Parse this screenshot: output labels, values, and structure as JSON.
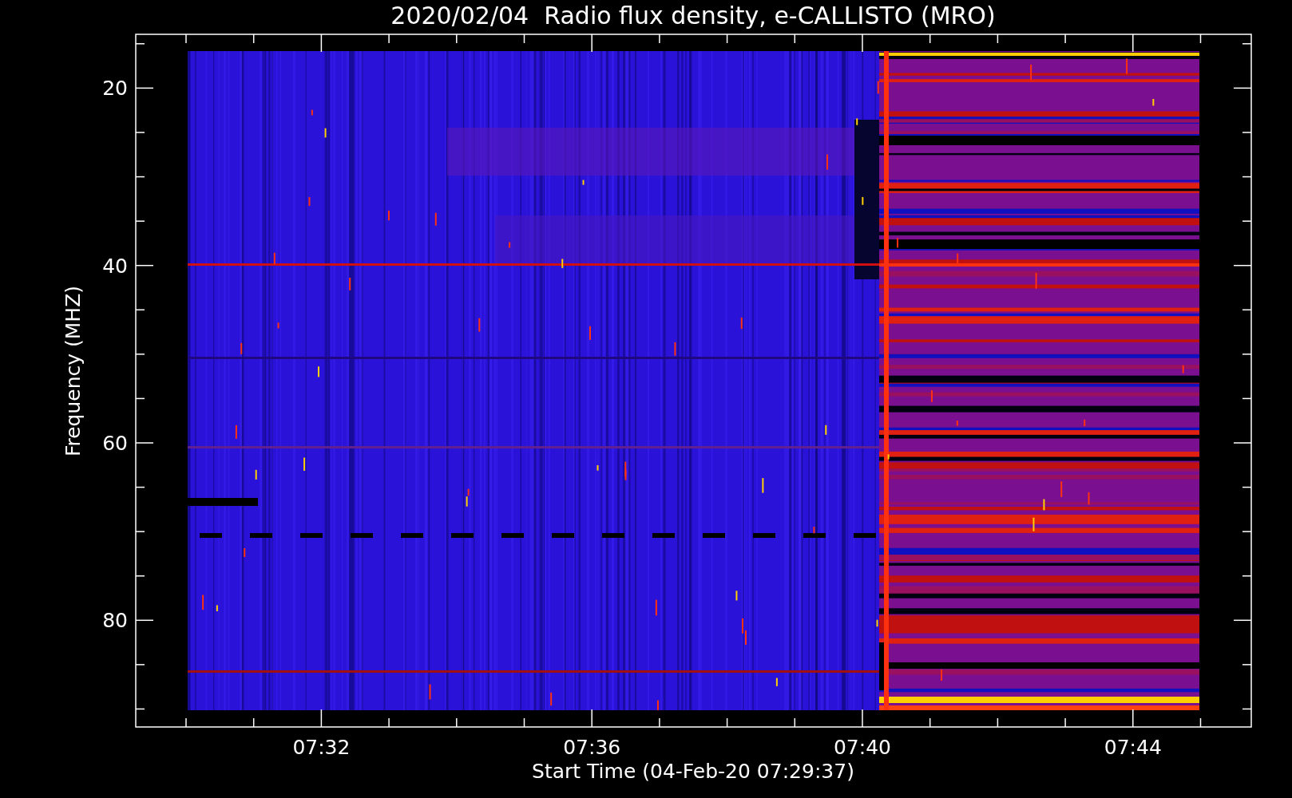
{
  "title": "2020/02/04  Radio flux density, e-CALLISTO (MRO)",
  "y_axis": {
    "label": "Frequency (MHZ)",
    "ticks": [
      "20",
      "40",
      "60",
      "80"
    ]
  },
  "x_axis": {
    "label": "Start Time (04-Feb-20 07:29:37)",
    "ticks": [
      "07:32",
      "07:36",
      "07:40",
      "07:44"
    ]
  }
}
